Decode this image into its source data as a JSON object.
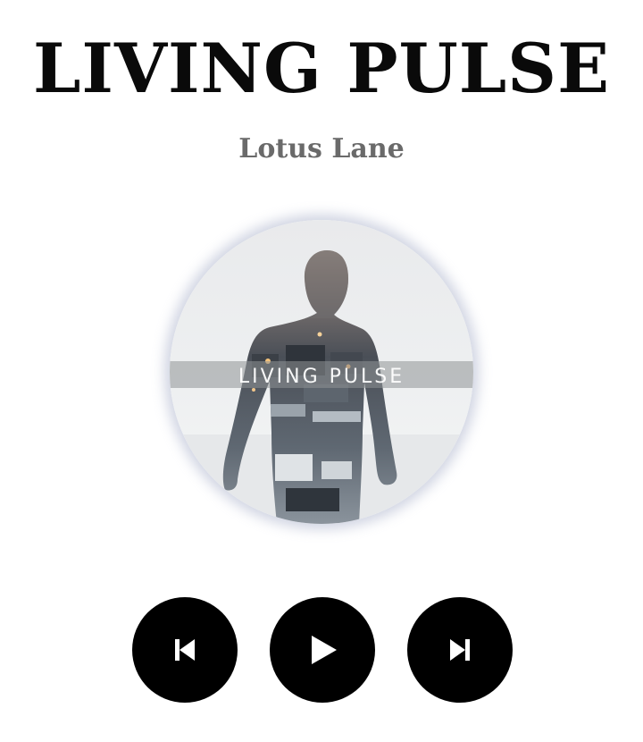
{
  "track": {
    "title": "LIVING PULSE",
    "artist": "Lotus Lane"
  },
  "artwork": {
    "cover_text": "LIVING PULSE"
  },
  "controls": {
    "previous_icon": "skip-previous-icon",
    "play_icon": "play-icon",
    "next_icon": "skip-next-icon"
  },
  "colors": {
    "title": "#0a0a0a",
    "artist": "#6a6a6a",
    "button_background": "#000000",
    "button_icon": "#ffffff"
  }
}
